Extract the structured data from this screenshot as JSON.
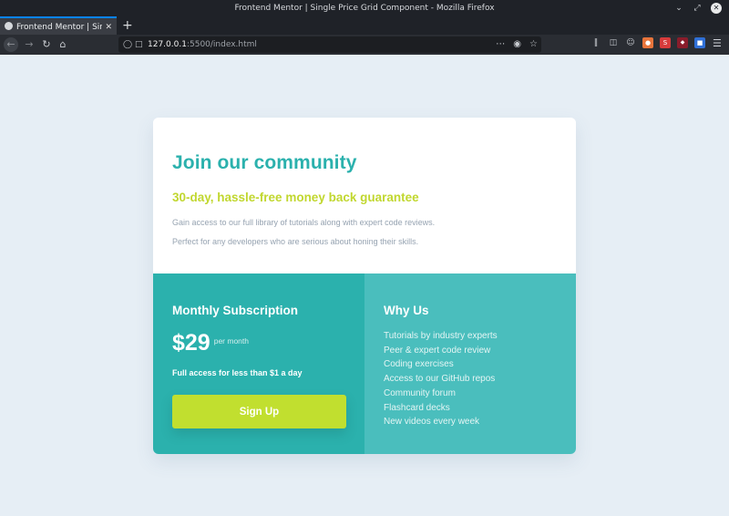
{
  "window": {
    "title": "Frontend Mentor | Single Price Grid Component - Mozilla Firefox",
    "controls": {
      "minimize": "⌄",
      "maximize": "⤢",
      "close": "✕"
    }
  },
  "tab": {
    "title": "Frontend Mentor | Sing",
    "close": "✕",
    "new_tab": "+"
  },
  "navbar": {
    "url_host": "127.0.0.1",
    "url_rest": ":5500/index.html",
    "icons": {
      "back": "back-arrow-icon",
      "forward": "forward-arrow-icon",
      "reload": "reload-icon",
      "home": "home-icon",
      "page_actions": "more-horizontal-icon",
      "pocket": "pocket-icon",
      "bookmark": "star-icon",
      "library": "library-icon",
      "sidebar": "sidebar-icon",
      "account": "account-icon",
      "extensions": [
        "duckduckgo-icon",
        "extension-s-icon",
        "ublock-icon",
        "bitwarden-icon"
      ],
      "menu": "hamburger-menu-icon"
    }
  },
  "card": {
    "title": "Join our community",
    "subtitle": "30-day, hassle-free money back guarantee",
    "description_1": "Gain access to our full library of tutorials along with expert code reviews.",
    "description_2": "Perfect for any developers who are serious about honing their skills.",
    "subscription": {
      "heading": "Monthly Subscription",
      "price": "$29",
      "unit": "per month",
      "note": "Full access for less than $1 a day",
      "button_label": "Sign Up"
    },
    "why_us": {
      "heading": "Why Us",
      "items": [
        "Tutorials by industry experts",
        "Peer & expert code review",
        "Coding exercises",
        "Access to our GitHub repos",
        "Community forum",
        "Flashcard decks",
        "New videos every week"
      ]
    }
  },
  "colors": {
    "accent_teal": "#2bb1ad",
    "light_teal": "#4abebd",
    "lime": "#c1df2f",
    "page_bg": "#e6eef5",
    "gray_text": "#96a3b1"
  }
}
